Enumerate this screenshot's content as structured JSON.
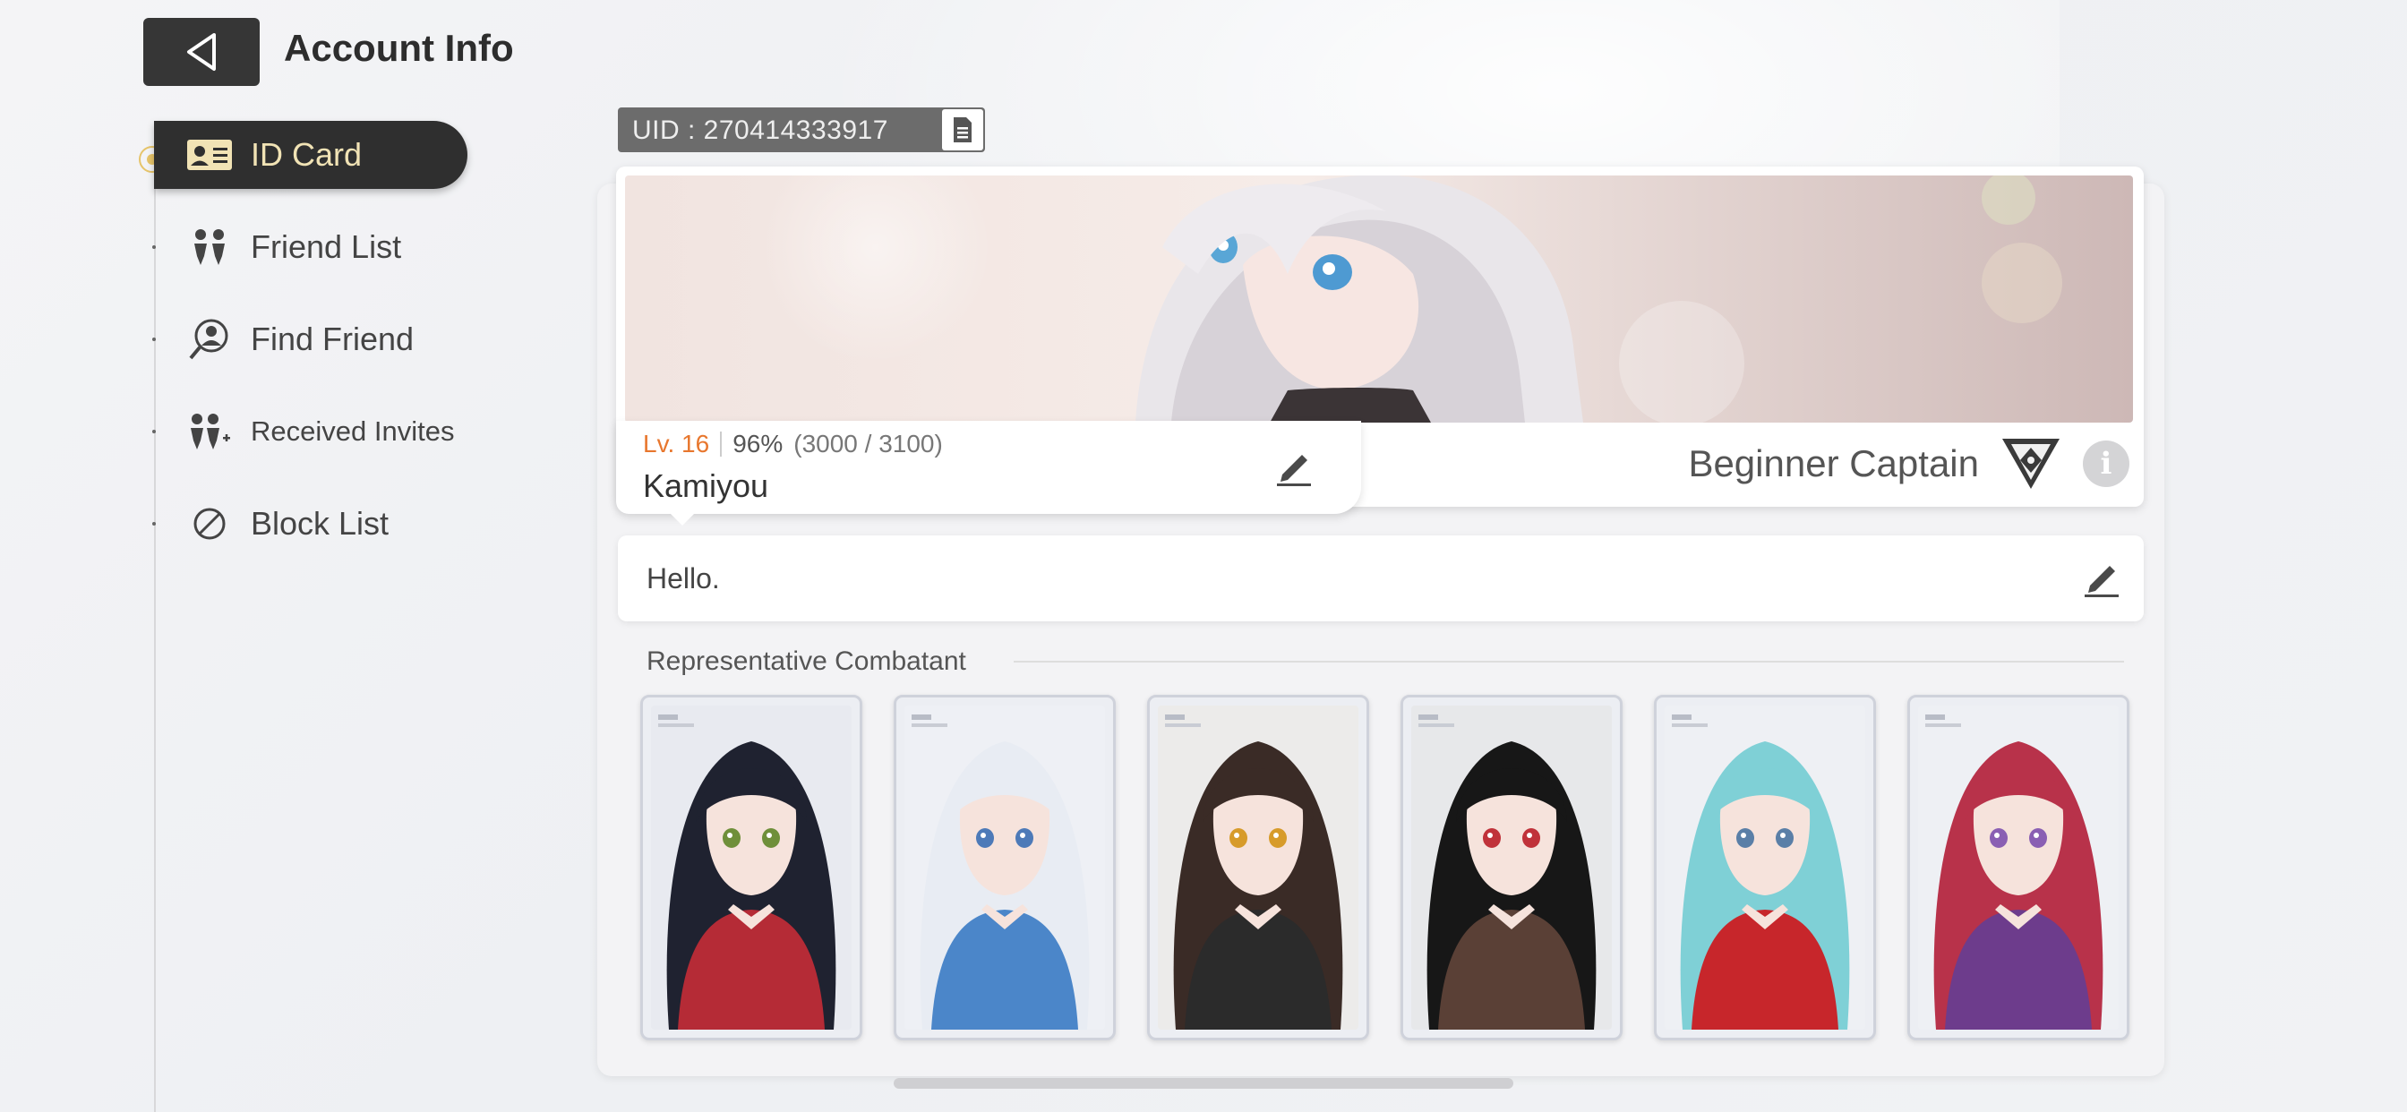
{
  "header": {
    "title": "Account Info"
  },
  "sidebar": {
    "items": [
      {
        "label": "ID Card",
        "icon": "id-card-icon",
        "active": true
      },
      {
        "label": "Friend List",
        "icon": "friends-icon",
        "active": false
      },
      {
        "label": "Find Friend",
        "icon": "find-person-icon",
        "active": false
      },
      {
        "label": "Received Invites",
        "icon": "invite-icon",
        "active": false
      },
      {
        "label": "Block List",
        "icon": "block-icon",
        "active": false
      }
    ]
  },
  "uid": {
    "label": "UID : 270414333917",
    "copy_icon": "copy-icon"
  },
  "profile": {
    "level": "Lv. 16",
    "exp_percent": "96%",
    "exp_raw": "(3000 / 3100)",
    "name": "Kamiyou",
    "title": "Beginner Captain",
    "greeting": "Hello."
  },
  "combatants": {
    "label": "Representative Combatant",
    "slots": [
      {
        "hair": "#1f2230",
        "accent": "#b52b36",
        "bg": "#e8eaf0",
        "eyes": "#6f8f3a"
      },
      {
        "hair": "#e8ecf3",
        "accent": "#4b86c9",
        "bg": "#eef0f5",
        "eyes": "#4d7ab8"
      },
      {
        "hair": "#3a2b26",
        "accent": "#2b2b2b",
        "bg": "#ecebea",
        "eyes": "#d79b2a"
      },
      {
        "hair": "#171717",
        "accent": "#5a4036",
        "bg": "#e7e8ea",
        "eyes": "#c0323a"
      },
      {
        "hair": "#7fd0d6",
        "accent": "#c7262b",
        "bg": "#eef0f4",
        "eyes": "#5a7fa7"
      },
      {
        "hair": "#b8324a",
        "accent": "#6d3c8c",
        "bg": "#eef0f4",
        "eyes": "#8a5fb3"
      }
    ]
  },
  "colors": {
    "level_accent": "#e8772e",
    "active_text": "#f1e3b5",
    "active_bg": "#2f2f2f"
  }
}
